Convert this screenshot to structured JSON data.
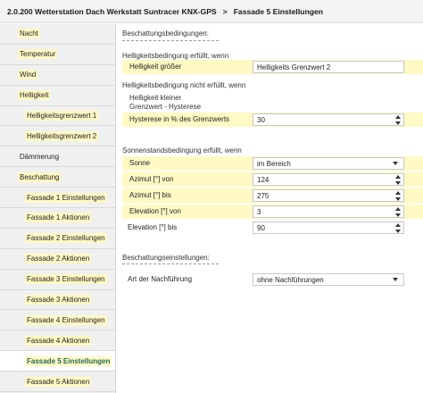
{
  "titlebar": {
    "device": "2.0.200 Wetterstation Dach Werkstatt Suntracer KNX-GPS",
    "separator": ">",
    "page": "Fassade 5 Einstellungen"
  },
  "sidebar": {
    "items": [
      {
        "label": "Nacht"
      },
      {
        "label": "Temperatur"
      },
      {
        "label": "Wind"
      },
      {
        "label": "Helligkeit"
      },
      {
        "label": "Helligkeitsgrenzwert 1"
      },
      {
        "label": "Helligkeitsgrenzwert 2"
      },
      {
        "label": "Dämmerung"
      },
      {
        "label": "Beschattung"
      },
      {
        "label": "Fassade 1 Einstellungen"
      },
      {
        "label": "Fassade 1 Aktionen"
      },
      {
        "label": "Fassade 2 Einstellungen"
      },
      {
        "label": "Fassade 2 Aktionen"
      },
      {
        "label": "Fassade 3 Einstellungen"
      },
      {
        "label": "Fassade 3 Aktionen"
      },
      {
        "label": "Fassade 4 Einstellungen"
      },
      {
        "label": "Fassade 4 Aktionen"
      },
      {
        "label": "Fassade 5 Einstellungen"
      },
      {
        "label": "Fassade 5 Aktionen"
      }
    ],
    "active": "Fassade 5 Einstellungen"
  },
  "main": {
    "conditions_title": "Beschattungsbedingungen:",
    "bright_met_text": "Helligkeitsbedingung erfüllt, wenn",
    "brightness_label": "Helligkeit größer",
    "brightness_value": "Helligkeits Grenzwert 2",
    "bright_not_met_text": "Helligkeitsbedingung nicht erfüllt, wenn",
    "brightness_less_text": "Helligkeit kleiner",
    "limit_minus_text": "Grenzwert - Hysterese",
    "hysteresis_label": "Hysterese in % des Grenzwerts",
    "hysteresis_value": "30",
    "sun_condition_text": "Sonnenstandsbedingung erfüllt, wenn",
    "sun_label": "Sonne",
    "sun_value": "im Bereich",
    "azimuth_from_label": "Azimut [°] von",
    "azimuth_from_value": "124",
    "azimuth_to_label": "Azimut [°] bis",
    "azimuth_to_value": "275",
    "elevation_from_label": "Elevation [°] von",
    "elevation_from_value": "3",
    "elevation_to_label": "Elevation [°] bis",
    "elevation_to_value": "90",
    "settings_title": "Beschattungseinstellungen:",
    "tracking_label": "Art der Nachführung",
    "tracking_value": "ohne Nachführungen"
  },
  "colors": {
    "highlight": "#fff9c4",
    "active_text": "#1f6a5a",
    "sidebar_bg": "#f0f0f0"
  }
}
